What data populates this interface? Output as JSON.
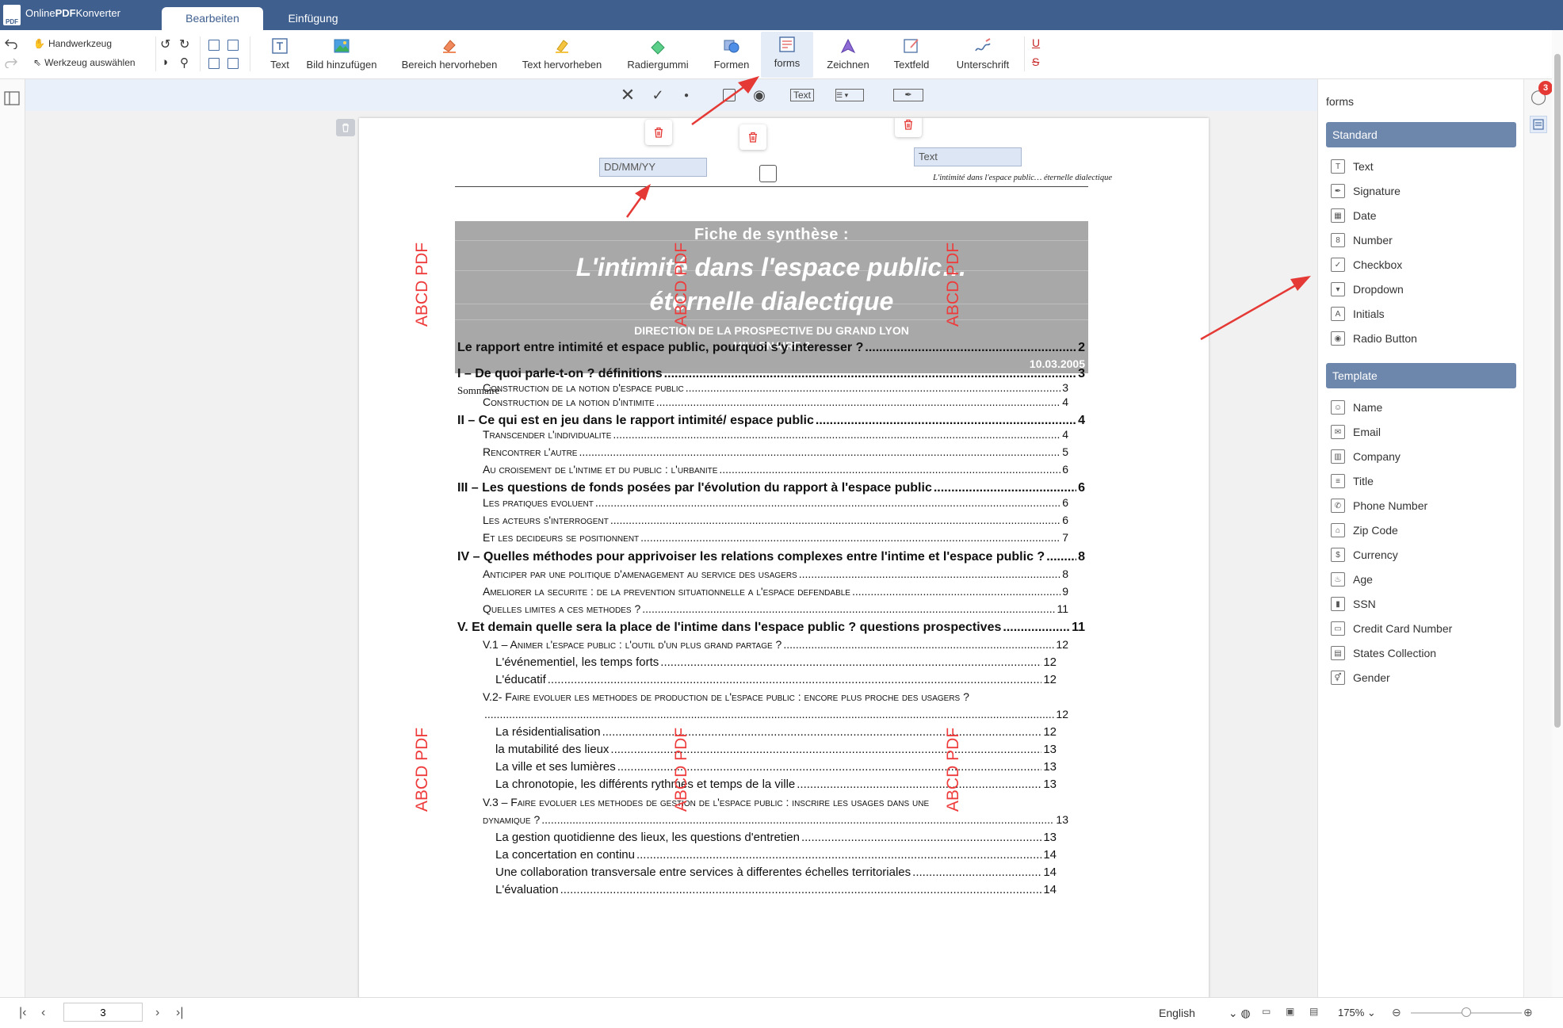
{
  "app": {
    "name_prefix": "Online",
    "name_bold": "PDF",
    "name_suffix": "Konverter",
    "logo_text": "PDF"
  },
  "tabs": [
    {
      "label": "Bearbeiten"
    },
    {
      "label": "Einfügung"
    }
  ],
  "toolbar": {
    "hand_tool": "Handwerkzeug",
    "select_tool": "Werkzeug auswählen",
    "tools": [
      {
        "label": "Text",
        "icon": "text-box-icon"
      },
      {
        "label": "Bild hinzufügen",
        "icon": "image-icon"
      },
      {
        "label": "Bereich hervorheben",
        "icon": "area-highlight-icon"
      },
      {
        "label": "Text hervorheben",
        "icon": "highlighter-icon"
      },
      {
        "label": "Radiergummi",
        "icon": "eraser-icon"
      },
      {
        "label": "Formen",
        "icon": "shapes-icon"
      },
      {
        "label": "forms",
        "icon": "forms-icon"
      },
      {
        "label": "Zeichnen",
        "icon": "pen-icon"
      },
      {
        "label": "Textfeld",
        "icon": "textfield-icon"
      },
      {
        "label": "Unterschrift",
        "icon": "signature-icon"
      }
    ],
    "underline_glyph": "U",
    "strike_glyph": "S"
  },
  "subbar": {
    "text_field_label": "Text"
  },
  "document": {
    "date_field_placeholder": "DD/MM/YY",
    "text_field_value": "Text",
    "header_right": "L'intimité dans l'espace public… éternelle dialectique",
    "banner": {
      "line1": "Fiche de synthèse :",
      "line2": "L'intimité dans l'espace public…",
      "line3": "éternelle dialectique",
      "line4": "DIRECTION DE LA PROSPECTIVE DU GRAND LYON",
      "line5": "MILLENAIRE 3",
      "date": "10.03.2005"
    },
    "sommaire": "Sommaire",
    "watermark": "ABCD PDF",
    "toc": [
      {
        "level": 1,
        "text": "Le rapport entre intimité et espace public, pourquoi s'y interesser ?",
        "page": "2"
      },
      {
        "level": 1,
        "text": "I – De quoi parle-t-on ? définitions",
        "page": "3"
      },
      {
        "level": 2,
        "text": "Construction de la notion d'espace public",
        "page": "3"
      },
      {
        "level": 2,
        "text": "Construction de la notion d'intimite",
        "page": "4"
      },
      {
        "level": 1,
        "text": "II – Ce qui est en jeu dans le rapport intimité/ espace public",
        "page": "4"
      },
      {
        "level": 2,
        "text": "Transcender l'individualite",
        "page": "4"
      },
      {
        "level": 2,
        "text": "Rencontrer l'autre",
        "page": "5"
      },
      {
        "level": 2,
        "text": "Au croisement de l'intime et du public : l'urbanite",
        "page": "6"
      },
      {
        "level": 1,
        "text": "III – Les questions de fonds posées par l'évolution du rapport à l'espace public",
        "page": "6"
      },
      {
        "level": 2,
        "text": "Les pratiques evoluent",
        "page": "6"
      },
      {
        "level": 2,
        "text": "Les acteurs s'interrogent",
        "page": "6"
      },
      {
        "level": 2,
        "text": "Et les decideurs se positionnent",
        "page": "7"
      },
      {
        "level": 1,
        "text": "IV – Quelles méthodes pour apprivoiser les relations complexes entre l'intime et l'espace public ?",
        "page": "8"
      },
      {
        "level": 2,
        "text": "Anticiper par une politique d'amenagement au service des usagers",
        "page": "8"
      },
      {
        "level": 2,
        "text": "Ameliorer la securite : de la prevention situationnelle a l'espace defendable",
        "page": "9"
      },
      {
        "level": 2,
        "text": "Quelles limites a ces methodes ?",
        "page": "11"
      },
      {
        "level": 1,
        "text": "V. Et demain quelle sera la place de l'intime dans l'espace public ? questions prospectives",
        "page": "11"
      },
      {
        "level": 2,
        "text": "V.1 – Animer l'espace public : l'outil d'un plus grand partage ?",
        "page": "12"
      },
      {
        "level": 3,
        "text": "L'événementiel, les temps forts",
        "page": "12"
      },
      {
        "level": 3,
        "text": "L'éducatif",
        "page": "12"
      },
      {
        "level": 2,
        "text": "V.2- Faire evoluer les methodes de production de l'espace public : encore plus proche des usagers ?",
        "page": ""
      },
      {
        "level": 2,
        "text": "",
        "page": "12"
      },
      {
        "level": 3,
        "text": "La résidentialisation",
        "page": "12"
      },
      {
        "level": 3,
        "text": "la mutabilité des lieux",
        "page": "13"
      },
      {
        "level": 3,
        "text": "La ville et ses lumières",
        "page": "13"
      },
      {
        "level": 3,
        "text": "La chronotopie, les différents rythmes et temps de la ville",
        "page": "13"
      },
      {
        "level": 2,
        "text": "V.3 – Faire evoluer les methodes de gestion de l'espace public : inscrire les usages dans une",
        "page": ""
      },
      {
        "level": 2,
        "text": "dynamique ?",
        "page": "13"
      },
      {
        "level": 3,
        "text": "La gestion quotidienne des lieux, les questions d'entretien",
        "page": "13"
      },
      {
        "level": 3,
        "text": "La concertation en continu",
        "page": "14"
      },
      {
        "level": 3,
        "text": "Une collaboration transversale entre services à differentes échelles territoriales",
        "page": "14"
      },
      {
        "level": 3,
        "text": "L'évaluation",
        "page": "14"
      }
    ]
  },
  "panel": {
    "title": "forms",
    "standard_header": "Standard",
    "standard_items": [
      {
        "label": "Text",
        "icon": "text-field-icon",
        "glyph": "T"
      },
      {
        "label": "Signature",
        "icon": "signature-pen-icon",
        "glyph": "✒"
      },
      {
        "label": "Date",
        "icon": "calendar-icon",
        "glyph": "▦"
      },
      {
        "label": "Number",
        "icon": "number-icon",
        "glyph": "8"
      },
      {
        "label": "Checkbox",
        "icon": "checkbox-icon",
        "glyph": "✓"
      },
      {
        "label": "Dropdown",
        "icon": "dropdown-icon",
        "glyph": "▾"
      },
      {
        "label": "Initials",
        "icon": "initials-icon",
        "glyph": "A"
      },
      {
        "label": "Radio Button",
        "icon": "radio-button-icon",
        "glyph": "◉"
      }
    ],
    "template_header": "Template",
    "template_items": [
      {
        "label": "Name",
        "icon": "person-icon",
        "glyph": "☺"
      },
      {
        "label": "Email",
        "icon": "email-icon",
        "glyph": "✉"
      },
      {
        "label": "Company",
        "icon": "building-icon",
        "glyph": "▥"
      },
      {
        "label": "Title",
        "icon": "list-icon",
        "glyph": "≡"
      },
      {
        "label": "Phone Number",
        "icon": "phone-icon",
        "glyph": "✆"
      },
      {
        "label": "Zip Code",
        "icon": "zip-icon",
        "glyph": "⌂"
      },
      {
        "label": "Currency",
        "icon": "currency-icon",
        "glyph": "$"
      },
      {
        "label": "Age",
        "icon": "cake-icon",
        "glyph": "♨"
      },
      {
        "label": "SSN",
        "icon": "chart-icon",
        "glyph": "▮"
      },
      {
        "label": "Credit Card Number",
        "icon": "credit-card-icon",
        "glyph": "▭"
      },
      {
        "label": "States Collection",
        "icon": "states-icon",
        "glyph": "▤"
      },
      {
        "label": "Gender",
        "icon": "gender-icon",
        "glyph": "⚥"
      }
    ]
  },
  "notifications": {
    "count": "3"
  },
  "status": {
    "page": "3",
    "language": "English",
    "zoom": "175%"
  },
  "colors": {
    "titlebar": "#3f5f8f",
    "section_header": "#6d86ab",
    "watermark": "#ee3b3b",
    "arrow": "#e53935"
  }
}
